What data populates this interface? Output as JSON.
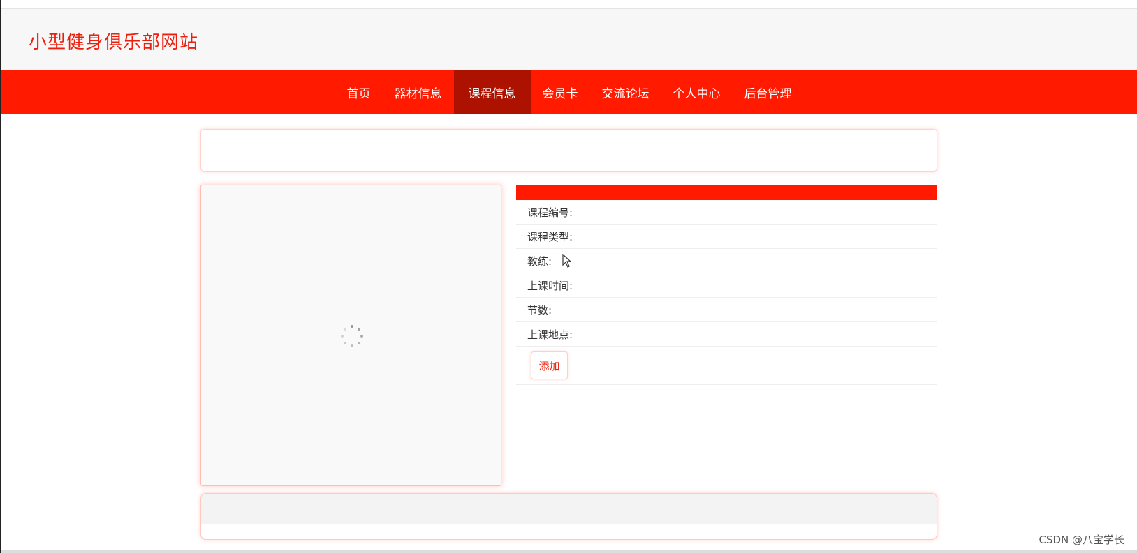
{
  "site": {
    "title": "小型健身俱乐部网站"
  },
  "nav": {
    "items": [
      {
        "label": "首页"
      },
      {
        "label": "器材信息"
      },
      {
        "label": "课程信息"
      },
      {
        "label": "会员卡"
      },
      {
        "label": "交流论坛"
      },
      {
        "label": "个人中心"
      },
      {
        "label": "后台管理"
      }
    ],
    "active": "课程信息"
  },
  "course": {
    "fields": [
      {
        "label": "课程编号:"
      },
      {
        "label": "课程类型:"
      },
      {
        "label": "教练:"
      },
      {
        "label": "上课时间:"
      },
      {
        "label": "节数:"
      },
      {
        "label": "上课地点:"
      }
    ],
    "add_label": "添加"
  },
  "watermark": "CSDN @八宝学长",
  "colors": {
    "accent": "#ff1a00",
    "nav_active": "#ad1200",
    "title": "#ec1f0e"
  }
}
